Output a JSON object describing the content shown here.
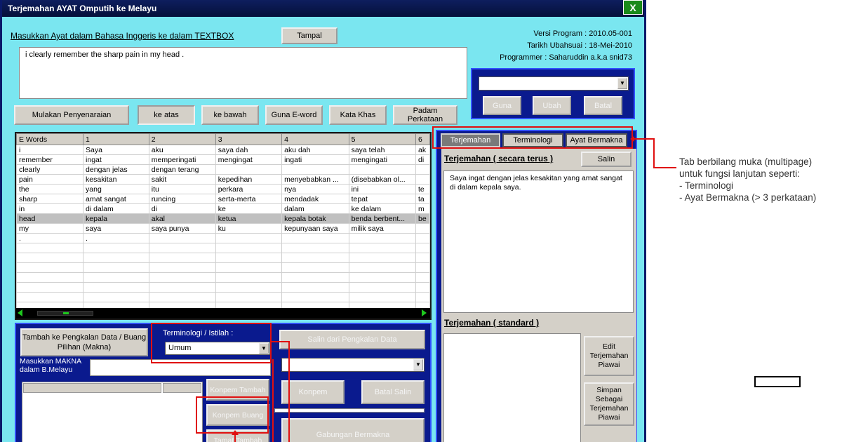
{
  "window": {
    "title": "Terjemahan AYAT Omputih ke Melayu",
    "close_label": "X"
  },
  "header": {
    "input_label": "Masukkan Ayat dalam Bahasa Inggeris ke dalam TEXTBOX",
    "paste_button": "Tampal",
    "version": "Versi Program : 2010.05-001",
    "update_date": "Tarikh Ubahsuai : 18-Mei-2010",
    "programmer": "Programmer : Saharuddin a.k.a snid73",
    "input_value": "i clearly remember the sharp pain in my head ."
  },
  "mini_panel": {
    "select_value": "",
    "buttons": [
      "Guna",
      "Ubah",
      "Batal"
    ]
  },
  "toolbar": {
    "start": "Mulakan Penyenaraian",
    "up": "ke atas",
    "down": "ke bawah",
    "eword": "Guna E-word",
    "special": "Kata Khas",
    "delete": "Padam Perkataan"
  },
  "grid": {
    "headers": [
      "E Words",
      "1",
      "2",
      "3",
      "4",
      "5",
      "6"
    ],
    "rows": [
      [
        "i",
        "Saya",
        "aku",
        "saya dah",
        "aku dah",
        "saya telah",
        "ak"
      ],
      [
        "remember",
        "ingat",
        "memperingati",
        "mengingat",
        "ingati",
        "mengingati",
        "di"
      ],
      [
        "clearly",
        "dengan jelas",
        "dengan terang",
        "",
        "",
        "",
        ""
      ],
      [
        "pain",
        "kesakitan",
        "sakit",
        "kepedihan",
        "menyebabkan ...",
        "(disebabkan ol...",
        ""
      ],
      [
        "the",
        "yang",
        "itu",
        "perkara",
        "nya",
        "ini",
        "te"
      ],
      [
        "sharp",
        "amat sangat",
        "runcing",
        "serta-merta",
        "mendadak",
        "tepat",
        "ta"
      ],
      [
        "in",
        "di dalam",
        "di",
        "ke",
        "dalam",
        "ke dalam",
        "m"
      ],
      [
        "head",
        "kepala",
        "akal",
        "ketua",
        "kepala botak",
        "benda berbent...",
        "be"
      ],
      [
        "my",
        "saya",
        "saya punya",
        "ku",
        "kepunyaan saya",
        "milik saya",
        ""
      ],
      [
        ".",
        ".",
        "",
        "",
        "",
        "",
        ""
      ]
    ],
    "selected_row": 7,
    "empty_rows": 7
  },
  "bottom_panel": {
    "add_button": "Tambah ke Pengkalan Data / Buang Pilihan (Makna)",
    "term_label": "Terminologi / Istilah :",
    "term_value": "Umum",
    "meaning_label_1": "Masukkan MAKNA",
    "meaning_label_2": "dalam B.Melayu",
    "meaning_value": "",
    "confirm_add": "Konpem Tambah",
    "confirm_delete": "Konpem Buang",
    "cancel_add": "Tamat Tambah",
    "copy_db": "Salin dari Pengkalan Data",
    "copy_select": "",
    "confirm": "Konpem",
    "cancel_copy": "Batal Salin",
    "combine": "Gabungan Bermakna"
  },
  "tabs": {
    "items": [
      "Terjemahan",
      "Terminologi",
      "Ayat Bermakna"
    ],
    "active": 0
  },
  "right_panel": {
    "direct_heading": "Terjemahan ( secara terus )",
    "copy_button": "Salin",
    "direct_text": "Saya ingat dengan jelas kesakitan yang amat sangat di dalam kepala saya.",
    "standard_heading": "Terjemahan ( standard )",
    "standard_text": "",
    "edit_button": "Edit Terjemahan Piawai",
    "save_button": "Simpan Sebagai Terjemahan Piawai"
  },
  "annotation": {
    "line1": "Tab  berbilang muka (multipage)",
    "line2": "untuk fungsi lanjutan seperti:",
    "line3": "- Terminologi",
    "line4": "- Ayat Bermakna (> 3 perkataan)"
  },
  "colors": {
    "window_bg": "#7ae6f0",
    "navy": "#0a1a8e",
    "annotation_red": "#e01010"
  }
}
